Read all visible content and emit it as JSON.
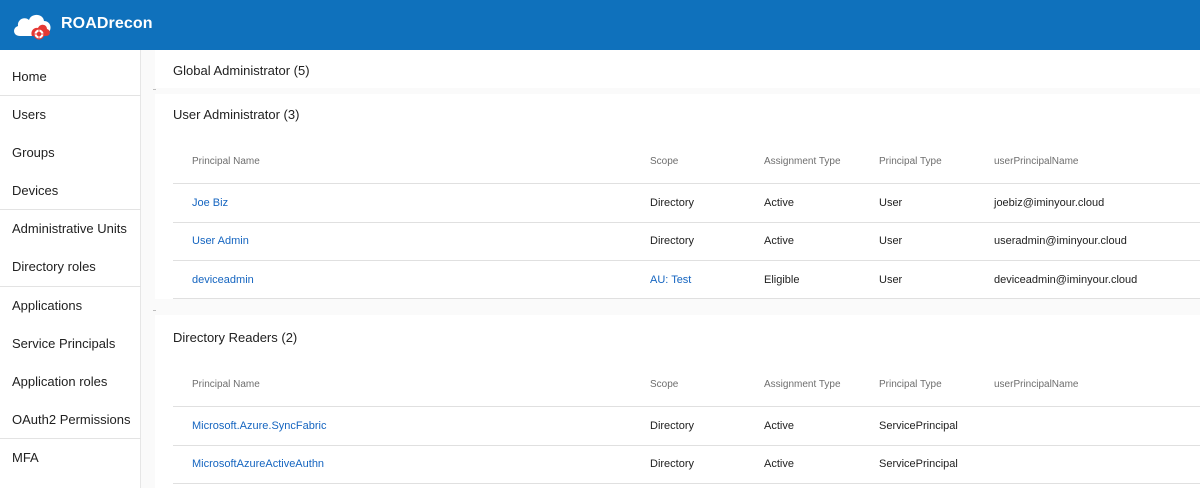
{
  "header": {
    "title": "ROADrecon",
    "brand_color": "#0f71bc"
  },
  "sidebar": {
    "items": [
      {
        "label": "Home"
      },
      {
        "label": "Users"
      },
      {
        "label": "Groups"
      },
      {
        "label": "Devices"
      },
      {
        "label": "Administrative Units"
      },
      {
        "label": "Directory roles"
      },
      {
        "label": "Applications"
      },
      {
        "label": "Service Principals"
      },
      {
        "label": "Application roles"
      },
      {
        "label": "OAuth2 Permissions"
      },
      {
        "label": "MFA"
      }
    ]
  },
  "roles": [
    {
      "title": "Global Administrator (5)"
    },
    {
      "title": "User Administrator (3)",
      "columns": [
        "Principal Name",
        "Scope",
        "Assignment Type",
        "Principal Type",
        "userPrincipalName"
      ],
      "rows": [
        {
          "name": "Joe Biz",
          "scope": "Directory",
          "assignment": "Active",
          "ptype": "User",
          "upn": "joebiz@iminyour.cloud"
        },
        {
          "name": "User Admin",
          "scope": "Directory",
          "assignment": "Active",
          "ptype": "User",
          "upn": "useradmin@iminyour.cloud"
        },
        {
          "name": "deviceadmin",
          "scope": "AU: Test",
          "assignment": "Eligible",
          "ptype": "User",
          "upn": "deviceadmin@iminyour.cloud"
        }
      ]
    },
    {
      "title": "Directory Readers (2)",
      "columns": [
        "Principal Name",
        "Scope",
        "Assignment Type",
        "Principal Type",
        "userPrincipalName"
      ],
      "rows": [
        {
          "name": "Microsoft.Azure.SyncFabric",
          "scope": "Directory",
          "assignment": "Active",
          "ptype": "ServicePrincipal",
          "upn": ""
        },
        {
          "name": "MicrosoftAzureActiveAuthn",
          "scope": "Directory",
          "assignment": "Active",
          "ptype": "ServicePrincipal",
          "upn": ""
        }
      ]
    }
  ]
}
